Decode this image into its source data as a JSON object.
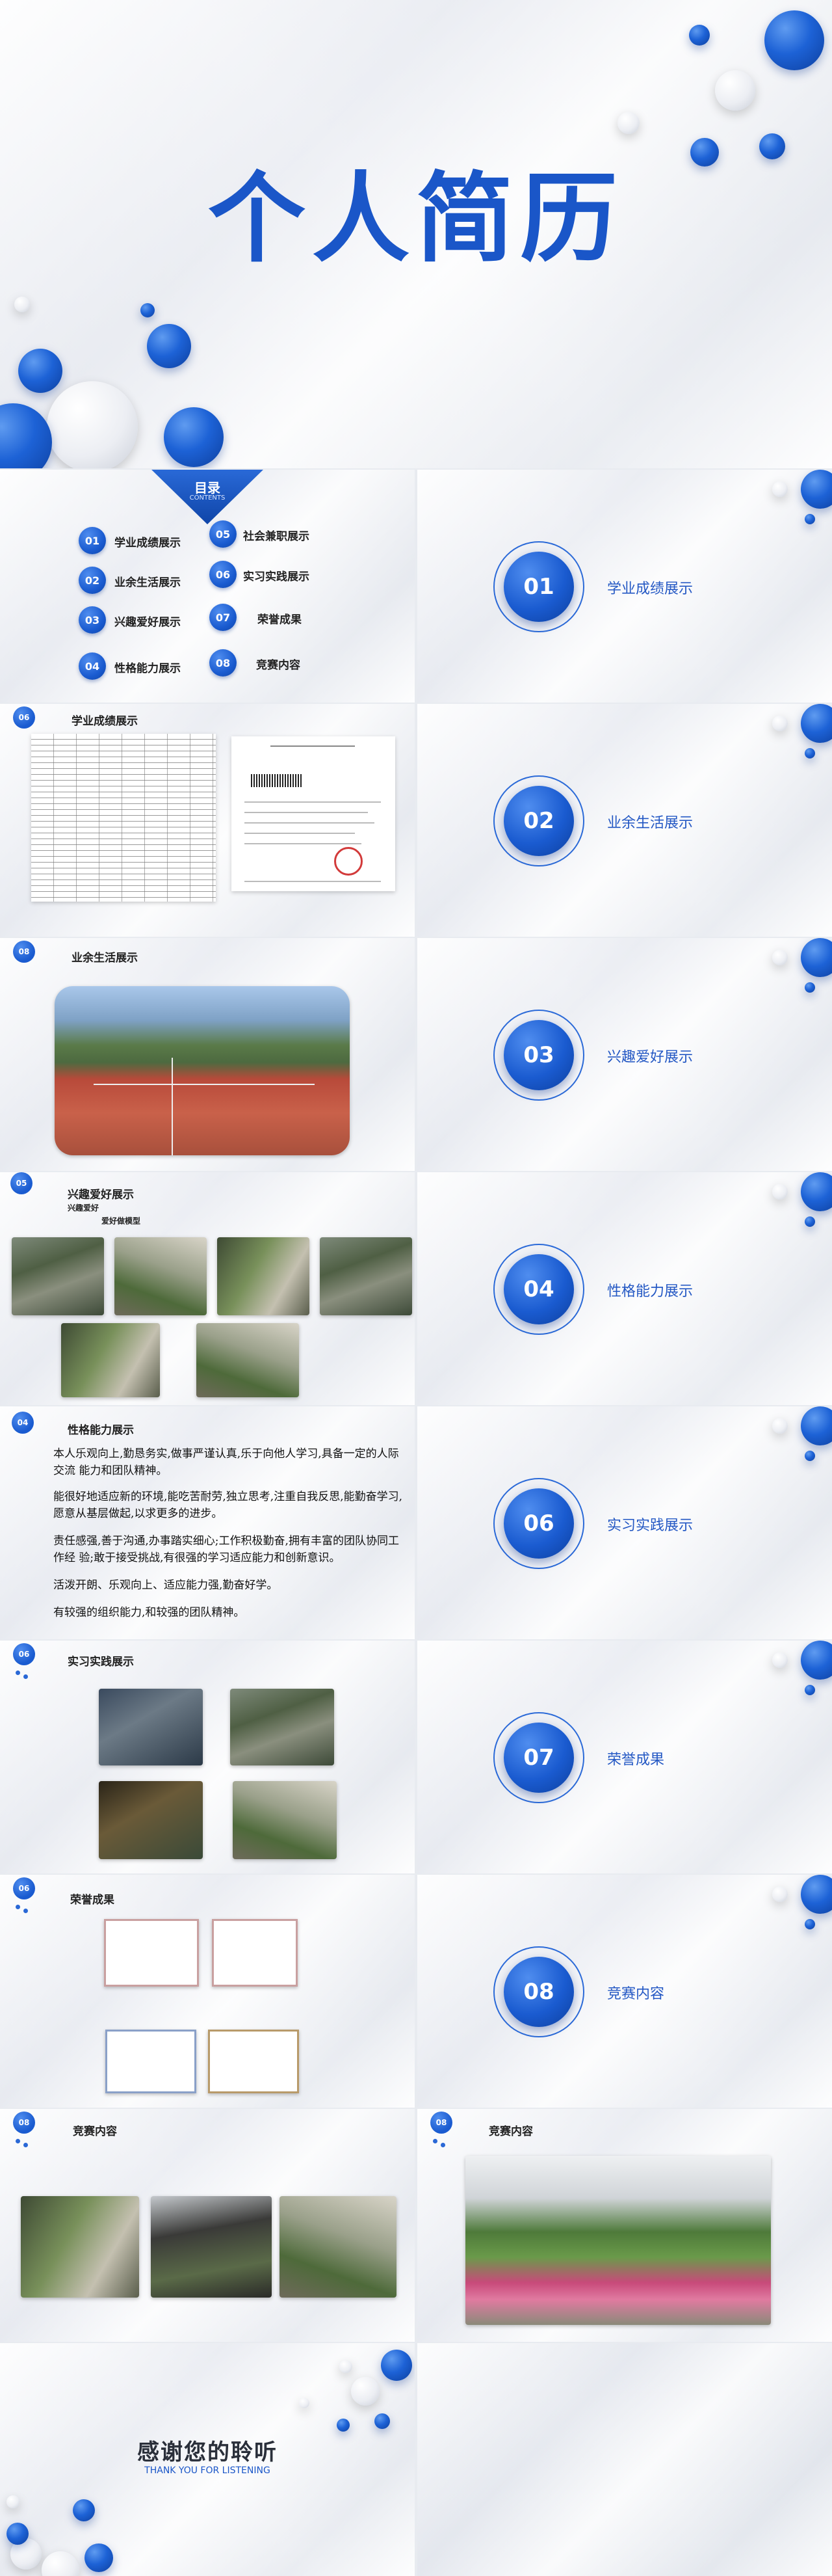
{
  "cover": {
    "title": "个人简历"
  },
  "toc": {
    "header": "目录",
    "header_sub": "CONTENTS",
    "items": [
      {
        "num": "01",
        "label": "学业成绩展示"
      },
      {
        "num": "02",
        "label": "业余生活展示"
      },
      {
        "num": "03",
        "label": "兴趣爱好展示"
      },
      {
        "num": "04",
        "label": "性格能力展示"
      },
      {
        "num": "05",
        "label": "社会兼职展示"
      },
      {
        "num": "06",
        "label": "实习实践展示"
      },
      {
        "num": "07",
        "label": "荣誉成果"
      },
      {
        "num": "08",
        "label": "竞赛内容"
      }
    ]
  },
  "sections": [
    {
      "num": "01",
      "title": "学业成绩展示"
    },
    {
      "num": "02",
      "title": "业余生活展示"
    },
    {
      "num": "03",
      "title": "兴趣爱好展示"
    },
    {
      "num": "04",
      "title": "性格能力展示"
    },
    {
      "num": "06",
      "title": "实习实践展示"
    },
    {
      "num": "07",
      "title": "荣誉成果"
    },
    {
      "num": "08",
      "title": "竞赛内容"
    }
  ],
  "details": {
    "academic": {
      "badge": "06",
      "title": "学业成绩展示"
    },
    "life": {
      "badge": "08",
      "title": "业余生活展示"
    },
    "hobby": {
      "badge": "05",
      "title": "兴趣爱好展示",
      "sub1": "兴趣爱好",
      "sub2": "爱好做模型"
    },
    "character": {
      "badge": "04",
      "title": "性格能力展示",
      "paragraphs": [
        "本人乐观向上,勤恳务实,做事严谨认真,乐于向他人学习,具备一定的人际交流 能力和团队精神。",
        "能很好地适应新的环境,能吃苦耐劳,独立思考,注重自我反思,能勤奋学习,愿意从基层做起,以求更多的进步。",
        "责任感强,善于沟通,办事踏实细心;工作积极勤奋,拥有丰富的团队协同工作经 验;敢于接受挑战,有很强的学习适应能力和创新意识。",
        "活泼开朗、乐观向上、适应能力强,勤奋好学。",
        "有较强的组织能力,和较强的团队精神。"
      ]
    },
    "practice": {
      "badge": "06",
      "title": "实习实践展示"
    },
    "honor": {
      "badge": "06",
      "title": "荣誉成果"
    },
    "contest1": {
      "badge": "08",
      "title": "竞赛内容"
    },
    "contest2": {
      "badge": "08",
      "title": "竞赛内容"
    }
  },
  "ending": {
    "title": "感谢您的聆听",
    "subtitle": "THANK YOU FOR LISTENING"
  },
  "colors": {
    "accent": "#1d62d6",
    "accent_dark": "#0d3f9e",
    "title_blue": "#1a56c8"
  }
}
